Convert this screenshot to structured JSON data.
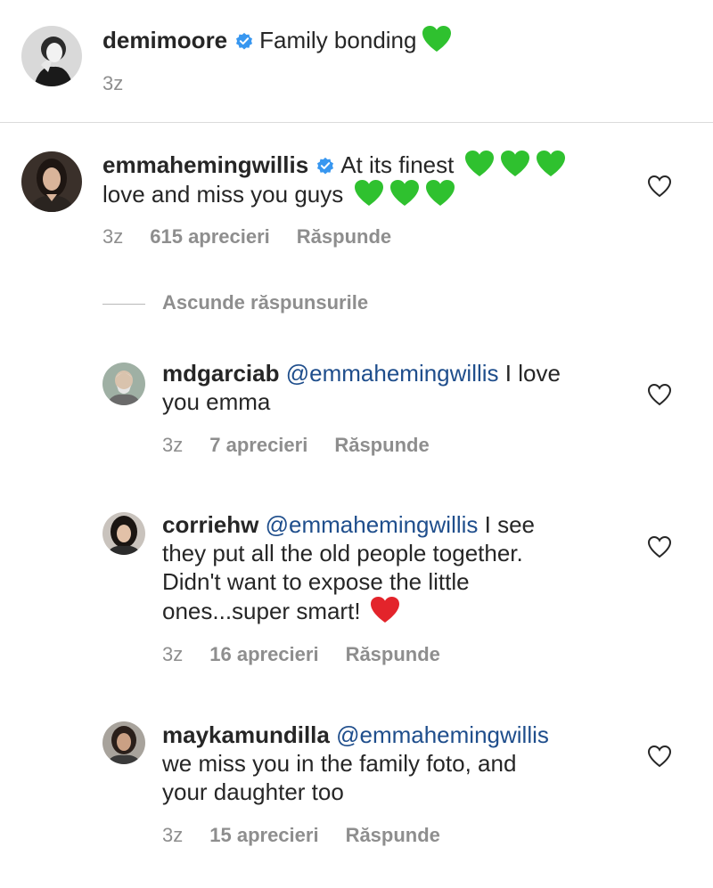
{
  "post": {
    "username": "demimoore",
    "caption": "Family bonding",
    "time": "3z"
  },
  "comments": [
    {
      "username": "emmahemingwillis",
      "line1": "At its finest",
      "line2": "love and miss you guys",
      "time": "3z",
      "likes": "615 aprecieri",
      "reply": "Răspunde"
    }
  ],
  "hide_replies_label": "Ascunde răspunsurile",
  "replies": [
    {
      "username": "mdgarciab",
      "mention": "@emmahemingwillis",
      "line1_rest": "I love",
      "line2": "you emma",
      "time": "3z",
      "likes": "7 aprecieri",
      "reply": "Răspunde"
    },
    {
      "username": "corriehw",
      "mention": "@emmahemingwillis",
      "line1_rest": "I see",
      "line2": "they put all the old people together.",
      "line3": "Didn't want to expose the little",
      "line4": "ones...super smart!",
      "time": "3z",
      "likes": "16 aprecieri",
      "reply": "Răspunde"
    },
    {
      "username": "maykamundilla",
      "mention": "@emmahemingwillis",
      "line2": "we miss you in the family foto, and",
      "line3": "your daughter too",
      "time": "3z",
      "likes": "15 aprecieri",
      "reply": "Răspunde"
    }
  ],
  "icons": {
    "verified": "verified-badge-icon",
    "green_heart": "green-heart-emoji",
    "red_heart": "red-heart-emoji",
    "like": "heart-outline-icon"
  },
  "colors": {
    "text": "#262626",
    "muted": "#8e8e8e",
    "mention": "#1f4e8c",
    "verified": "#3897f0",
    "green_heart": "#2fc12f",
    "red_heart": "#e3242b"
  }
}
